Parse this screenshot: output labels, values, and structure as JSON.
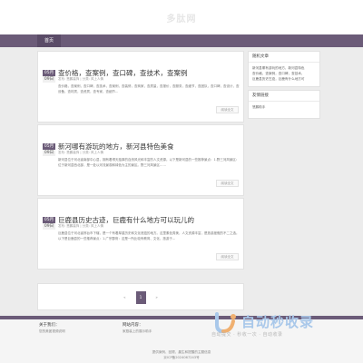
{
  "site": {
    "logo_text": "多肽网"
  },
  "nav": {
    "items": [
      {
        "label": "首页"
      }
    ]
  },
  "articles": [
    {
      "month": "05月",
      "day": "09日",
      "title": "查价格，查案例，查口碑，查技术，查案例",
      "meta": "发布: 慧鹏装饰 | 分类: 风上人情",
      "excerpt": "查价格，查案例，查口碑，查技术，查案例，查装修，查商家，查质量，查报价，查服务，查细节，查团队，查口碑，查设计，查设备，查材质，查资质，查专家，查细节...",
      "read_more": "阅读全文"
    },
    {
      "month": "05月",
      "day": "09日",
      "title": "新河哪有游玩的地方，新河县特色美食",
      "meta": "发布: 慧鹏装饰 | 分类: 风上人情",
      "excerpt": "新河县位于河北省南部中心县，拥有着得天独厚的自然风光和丰富的人文资源。以下是新河县的一些推荐景点：1.野三河风景区：位于新河县西北部，是一处以河流景观和绿色为主的景区。野三河风景区……",
      "read_more": "阅读全文"
    },
    {
      "month": "05月",
      "day": "09日",
      "title": "巨鹿县历史古迹，巨鹿有什么地方可以玩儿的",
      "meta": "发布: 慧鹏装饰 | 分类: 风上人情",
      "excerpt": "巨鹿县位于河北省邢台市下辖，是一个有着厚重历史和文化底蕴的地方。这里素色秀美，人文资源丰富，是旅游度假的不二之选。以下是巨鹿县的一些推荐景点：1.广宗郡府：这是一所比较有教育、文化、旅游于...",
      "read_more": "阅读全文"
    }
  ],
  "pagination": {
    "prev": "«",
    "current": "1",
    "next": "»"
  },
  "sidebar": {
    "random_title": "随机文章",
    "random_items": [
      "新河县哪有游玩的地方，新河县特色",
      "查价格，查案例，查口碑，查技术，",
      "巨鹿县历史古迹，巨鹿有什么地方可"
    ],
    "links_title": "友情链接",
    "links_items": [
      "慧鹏助手"
    ]
  },
  "footer": {
    "about_heading": "关于我们：",
    "about_text": "您的美团视频说明",
    "links_heading": "网站内容：",
    "links_text": "家庭装上的展示助手",
    "copy_line1": "提供案例、回顾、晨生和提醒的主题信息",
    "copy_line2": "京ICP备2024067243号"
  },
  "watermark": {
    "brand": "自动秒收录",
    "tagline": "自动提交 · 秒收一次 · 自动收录"
  },
  "colors": {
    "accent": "#6b5b78",
    "page_bg": "#ececec",
    "watermark_blue": "#a9c8ea"
  }
}
